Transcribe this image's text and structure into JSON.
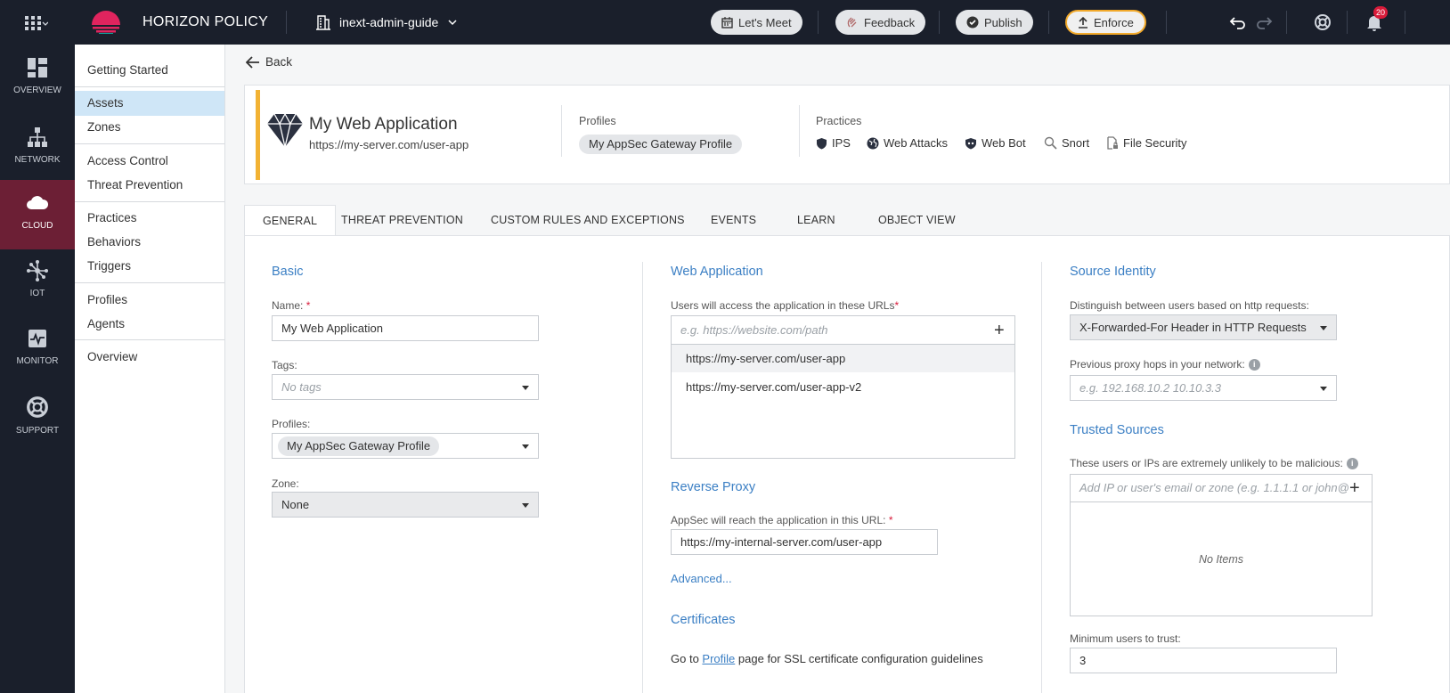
{
  "topbar": {
    "app_title": "HORIZON POLICY",
    "workspace": "inext-admin-guide",
    "buttons": {
      "lets_meet": "Let's Meet",
      "feedback": "Feedback",
      "publish": "Publish",
      "enforce": "Enforce"
    },
    "notifications_count": "20",
    "colors": {
      "bg": "#1a1f2b",
      "enforce_border": "#f2a92a",
      "badge": "#d81b3a"
    }
  },
  "leftnav": {
    "items": [
      {
        "label": "OVERVIEW",
        "icon": "dashboard-icon"
      },
      {
        "label": "NETWORK",
        "icon": "network-icon"
      },
      {
        "label": "CLOUD",
        "icon": "cloud-icon",
        "active": true
      },
      {
        "label": "IOT",
        "icon": "iot-icon"
      },
      {
        "label": "MONITOR",
        "icon": "monitor-icon"
      },
      {
        "label": "SUPPORT",
        "icon": "lifebuoy-icon"
      }
    ]
  },
  "subnav": {
    "items": [
      "Getting Started",
      "Assets",
      "Zones",
      "Access Control",
      "Threat Prevention",
      "Practices",
      "Behaviors",
      "Triggers",
      "Profiles",
      "Agents",
      "Overview"
    ],
    "active": "Assets"
  },
  "back_label": "Back",
  "asset": {
    "name": "My Web Application",
    "url": "https://my-server.com/user-app",
    "profiles_label": "Profiles",
    "profile": "My AppSec Gateway Profile",
    "practices_label": "Practices",
    "practices": [
      "IPS",
      "Web Attacks",
      "Web Bot",
      "Snort",
      "File Security"
    ]
  },
  "tabs": [
    "GENERAL",
    "THREAT PREVENTION",
    "CUSTOM RULES AND EXCEPTIONS",
    "EVENTS",
    "LEARN",
    "OBJECT VIEW"
  ],
  "basic": {
    "title": "Basic",
    "name_label": "Name:",
    "name_value": "My Web Application",
    "tags_label": "Tags:",
    "tags_placeholder": "No tags",
    "profiles_label": "Profiles:",
    "profiles_value": "My AppSec Gateway Profile",
    "zone_label": "Zone:",
    "zone_value": "None"
  },
  "web_app": {
    "title": "Web Application",
    "urls_label": "Users will access the application in these URLs",
    "urls_placeholder": "e.g. https://website.com/path",
    "urls": [
      "https://my-server.com/user-app",
      "https://my-server.com/user-app-v2"
    ],
    "reverse_proxy_title": "Reverse Proxy",
    "reverse_proxy_label": "AppSec will reach the application in this URL:",
    "reverse_proxy_value": "https://my-internal-server.com/user-app",
    "advanced_link": "Advanced...",
    "certificates_title": "Certificates",
    "cert_text_before": "Go to",
    "cert_link": "Profile",
    "cert_text_after": "page for SSL certificate configuration guidelines"
  },
  "source_identity": {
    "title": "Source Identity",
    "distinguish_label": "Distinguish between users based on http requests:",
    "distinguish_value": "X-Forwarded-For Header in HTTP Requests",
    "proxy_hops_label": "Previous proxy hops in your network:",
    "proxy_hops_placeholder": "e.g. 192.168.10.2 10.10.3.3",
    "trusted_title": "Trusted Sources",
    "trusted_label": "These users or IPs are extremely unlikely to be malicious:",
    "trusted_placeholder": "Add IP or user's email or zone (e.g. 1.1.1.1 or john@",
    "no_items": "No Items",
    "min_users_label": "Minimum users to trust:",
    "min_users_value": "3"
  }
}
